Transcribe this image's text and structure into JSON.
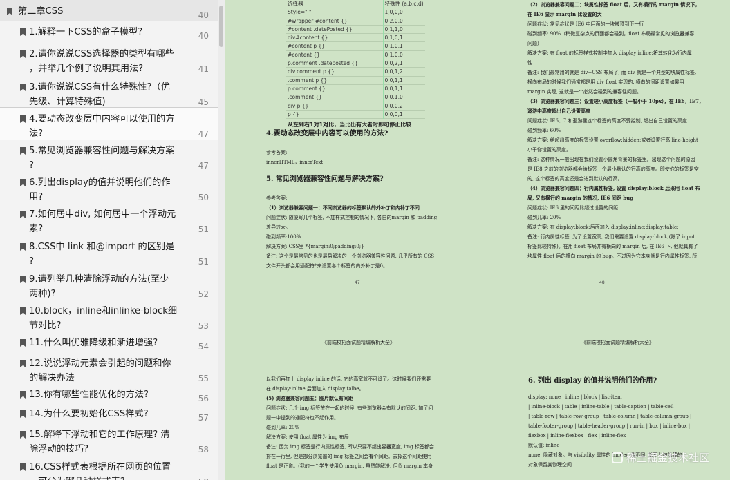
{
  "outline": {
    "items": [
      {
        "title": "第二章CSS",
        "page": "40",
        "level": 0
      },
      {
        "title": "1.解释一下CSS的盒子模型?",
        "page": "40",
        "level": 1
      },
      {
        "title": "2.请你说说CSS选择器的类型有哪些，并举几个例子说明其用法?",
        "title_lines": [
          "2.请你说说CSS选择器的类型有哪些",
          "，并举几个例子说明其用法?"
        ],
        "page": "41",
        "level": 1
      },
      {
        "title_lines": [
          "3.请你说说CSS有什么特殊性?（优",
          "先级、计算特殊值)"
        ],
        "page": "45",
        "level": 1
      },
      {
        "title_lines": [
          "4.要动态改变层中内容可以使用的方",
          "法?"
        ],
        "page": "47",
        "level": 1
      },
      {
        "title_lines": [
          "5.常见浏览器兼容性问题与解决方案",
          "?"
        ],
        "page": "47",
        "level": 1
      },
      {
        "title_lines": [
          "6.列出display的值并说明他们的作",
          "用?"
        ],
        "page": "50",
        "level": 1
      },
      {
        "title_lines": [
          "7.如何居中div, 如何居中一个浮动元",
          "素?"
        ],
        "page": "51",
        "level": 1
      },
      {
        "title_lines": [
          "8.CSS中 link 和@import 的区别是",
          "?"
        ],
        "page": "51",
        "level": 1
      },
      {
        "title_lines": [
          "9.请列举几种清除浮动的方法(至少",
          "两种)?"
        ],
        "page": "52",
        "level": 1
      },
      {
        "title_lines": [
          "10.block，inline和inlinke-block细",
          "节对比?"
        ],
        "page": "53",
        "level": 1
      },
      {
        "title_lines": [
          "11.什么叫优雅降级和渐进增强?"
        ],
        "page": "54",
        "level": 1
      },
      {
        "title_lines": [
          "12.说说浮动元素会引起的问题和你",
          "的解决办法"
        ],
        "page": "55",
        "level": 1
      },
      {
        "title_lines": [
          "13.你有哪些性能优化的方法?"
        ],
        "page": "56",
        "level": 1
      },
      {
        "title_lines": [
          "14.为什么要初始化CSS样式?"
        ],
        "page": "57",
        "level": 1
      },
      {
        "title_lines": [
          "15.解释下浮动和它的工作原理? 清",
          "除浮动的技巧?"
        ],
        "page": "58",
        "level": 1
      },
      {
        "title_lines": [
          "16.CSS样式表根据所在网页的位置",
          "，可分为哪几种样式表?"
        ],
        "page": "58",
        "level": 1
      }
    ]
  },
  "page47": {
    "table_header": [
      "选择器",
      "特殊性 (a,b,c,d)"
    ],
    "table_rows": [
      [
        "Style=\" \"",
        "1,0,0,0"
      ],
      [
        "#wrapper #content {}",
        "0,2,0,0"
      ],
      [
        "#content .datePosted {}",
        "0,1,1,0"
      ],
      [
        "div#content {}",
        "0,1,0,1"
      ],
      [
        "#content p {}",
        "0,1,0,1"
      ],
      [
        "#content {}",
        "0,1,0,0"
      ],
      [
        "p.comment .dateposted {}",
        "0,0,2,1"
      ],
      [
        "div.comment p {}",
        "0,0,1,2"
      ],
      [
        ".comment p {}",
        "0,0,1,1"
      ],
      [
        "p.comment {}",
        "0,0,1,1"
      ],
      [
        ".comment {}",
        "0,0,1,0"
      ],
      [
        "div p {}",
        "0,0,0,2"
      ],
      [
        "p {}",
        "0,0,0,1"
      ]
    ],
    "table_caption": "从左到右1对1对比，当比出有大者时即可停止比较",
    "q4_title": "4.要动态改变层中内容可以使用的方法?",
    "q4_answer_label": "参考答案:",
    "q4_answer": "innerHTML，innerText",
    "q5_title": "5. 常见浏览器兼容性问题与解决方案?",
    "q5_answer_label": "参考答案:",
    "q5_p1_title": "（1）浏览器兼容问题一：不同浏览器的标签默认的外补丁和内补丁不同",
    "q5_p1_lines": [
      "问题症状: 随便写几个标签, 不加样式控制的情况下, 各自的margin 和 padding",
      "差异较大。",
      "碰到频率:100%",
      "解决方案: CSS里 *{margin:0;padding:0;}",
      "备注: 这个是最常见的也是最易解决的一个浏览器兼容性问题, 几乎所有的 CSS",
      "文件开头都会用通配符*来设置各个标签的内外补丁是0。"
    ],
    "page_number": "47"
  },
  "page48": {
    "p2_title_lines": [
      "（2）浏览器兼容问题二：块属性标签 float 后，又有横行的 margin 情况下，",
      "在 IE6 显示 margin 比设置的大"
    ],
    "p2_lines": [
      "问题症状: 常见症状是 IE6 中后面的一块被顶到下一行",
      "碰到频率: 90%（稍微复杂点的页面都会碰到，float 布局最常见的浏览器兼容",
      "问题）",
      "解决方案: 在 float 的标签样式控制中加入 display:inline;将其转化为行内属",
      "性",
      "备注: 我们最常用的就是 div+CSS 布局了, 而 div 就是一个典型的块属性标签,",
      "横向布局的时候我们通常都是用 div float 实现的, 横向的间距设置如果用",
      "margin 实现, 这就是一个必然会碰到的兼容性问题。"
    ],
    "p3_title_lines": [
      "（3）浏览器兼容问题三：设置较小高度标签（一般小于 10px），在 IE6，IE7，",
      "遨游中高度超出自己设置高度"
    ],
    "p3_lines": [
      "问题症状: IE6、7 和遨游里这个标签的高度不受控制, 超出自己设置的高度",
      "碰到频率: 60%",
      "解决方案: 给超出高度的标签设置 overflow:hidden;或者设置行高 line-height",
      "小于你设置的高度。",
      "备注: 这种情况一般出现在我们设置小圆角背景的标签里。出现这个问题的原因",
      "是 IE8 之前的浏览器都会给标签一个最小默认的行高的高度。即使你的标签是空",
      "的, 这个标签的高度还是会达到默认的行高。"
    ],
    "p4_title_lines": [
      "（4）浏览器兼容问题四：行内属性标签, 设置 display:block 后采用 float 布",
      "局, 又有横行的 margin 的情况, IE6 间距 bug"
    ],
    "p4_lines": [
      "问题症状: IE6 里的间距比超过设置的间距",
      "碰到几率: 20%",
      "解决方案: 在 display:block;后面加入 display:inline;display:table;",
      "备注: 行内属性标签, 为了设置宽高, 我们需要设置 display:block;(除了 input",
      "标签比较特殊)。在用 float 布局并有横向的 margin 后, 在 IE6 下, 他就具有了",
      "块属性 float 后的横向 margin 的 bug。不过因为它本身就是行内属性标签, 所"
    ],
    "page_number": "48"
  },
  "page49": {
    "header": "《前端校招面试题精编解析大全》",
    "lines": [
      "以我们再加上 display:inline 的话, 它的高宽就不可设了。这时候我们还需要",
      "在 display:inline 后面加入 display:talbe。"
    ],
    "p5_title": "(5) 浏览器兼容问题五：图片默认有间距",
    "p5_lines": [
      "问题症状: 几个 img 标签放在一起的时候, 有些浏览器会有默认的间距, 加了问",
      "题一中提到的通配符也不起作用。",
      "碰到几率: 20%",
      "解决方案: 使用 float 属性为 img 布局",
      "备注: 因为 img 标签是行内属性标签, 所以只要不超出容器宽度, img 标签都会",
      "排在一行里, 但是部分浏览器的 img 标签之间会有个间距。去掉这个间距使用",
      "float 是正道。(我的一个学生使用负 margin, 虽然能解决, 但负 margin 本身"
    ]
  },
  "page50": {
    "header": "《前端校招面试题精编解析大全》",
    "q6_title": "6. 列出 display 的值并说明他们的作用?",
    "values_lines": [
      "display:   none   |  inline  |  block  |  list-item",
      "| inline-block  |  table  |  inline-table  |  table-caption  |  table-cell",
      "| table-row  |  table-row-group  |  table-column  |  table-column-group  |",
      "table-footer-group  |  table-header-group  |  run-in  |  box  |  inline-box  |",
      "flexbox  |  inline-flexbox  |  flex  |  inline-flex"
    ],
    "default_line": "默认值: inline",
    "none_line": "none:   隐藏对象。与 visibility 属性的 hidden 值不同, 其不为被隐藏的",
    "none_line2": "对象保留其物理空间"
  },
  "watermark": "稀土掘金技术社区",
  "colors": {
    "page_bg": "#cfe3c6",
    "sidebar_bg": "#f3f3f3",
    "selected_row": "#e6e6e6"
  }
}
